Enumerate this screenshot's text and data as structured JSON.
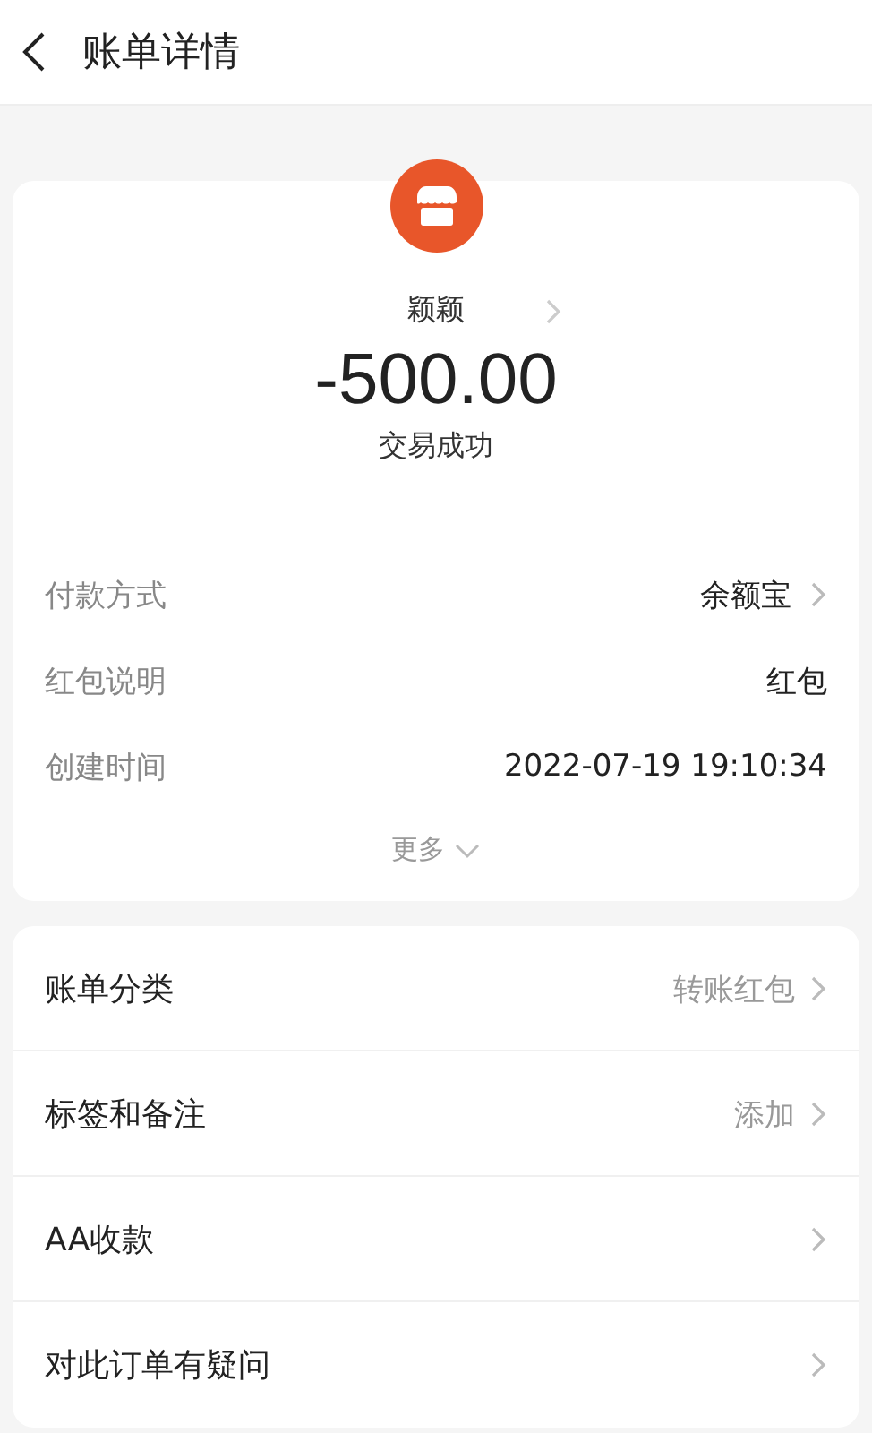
{
  "header": {
    "title": "账单详情"
  },
  "summary": {
    "payee": "颖颖",
    "amount": "-500.00",
    "status": "交易成功"
  },
  "details": [
    {
      "label": "付款方式",
      "value": "余额宝",
      "chevron": true
    },
    {
      "label": "红包说明",
      "value": "红包",
      "chevron": false
    },
    {
      "label": "创建时间",
      "value": "2022-07-19 19:10:34",
      "chevron": false
    }
  ],
  "more": "更多",
  "menu": [
    {
      "label": "账单分类",
      "value": "转账红包"
    },
    {
      "label": "标签和备注",
      "value": "添加"
    },
    {
      "label": "AA收款"
    },
    {
      "label": "对此订单有疑问"
    }
  ]
}
